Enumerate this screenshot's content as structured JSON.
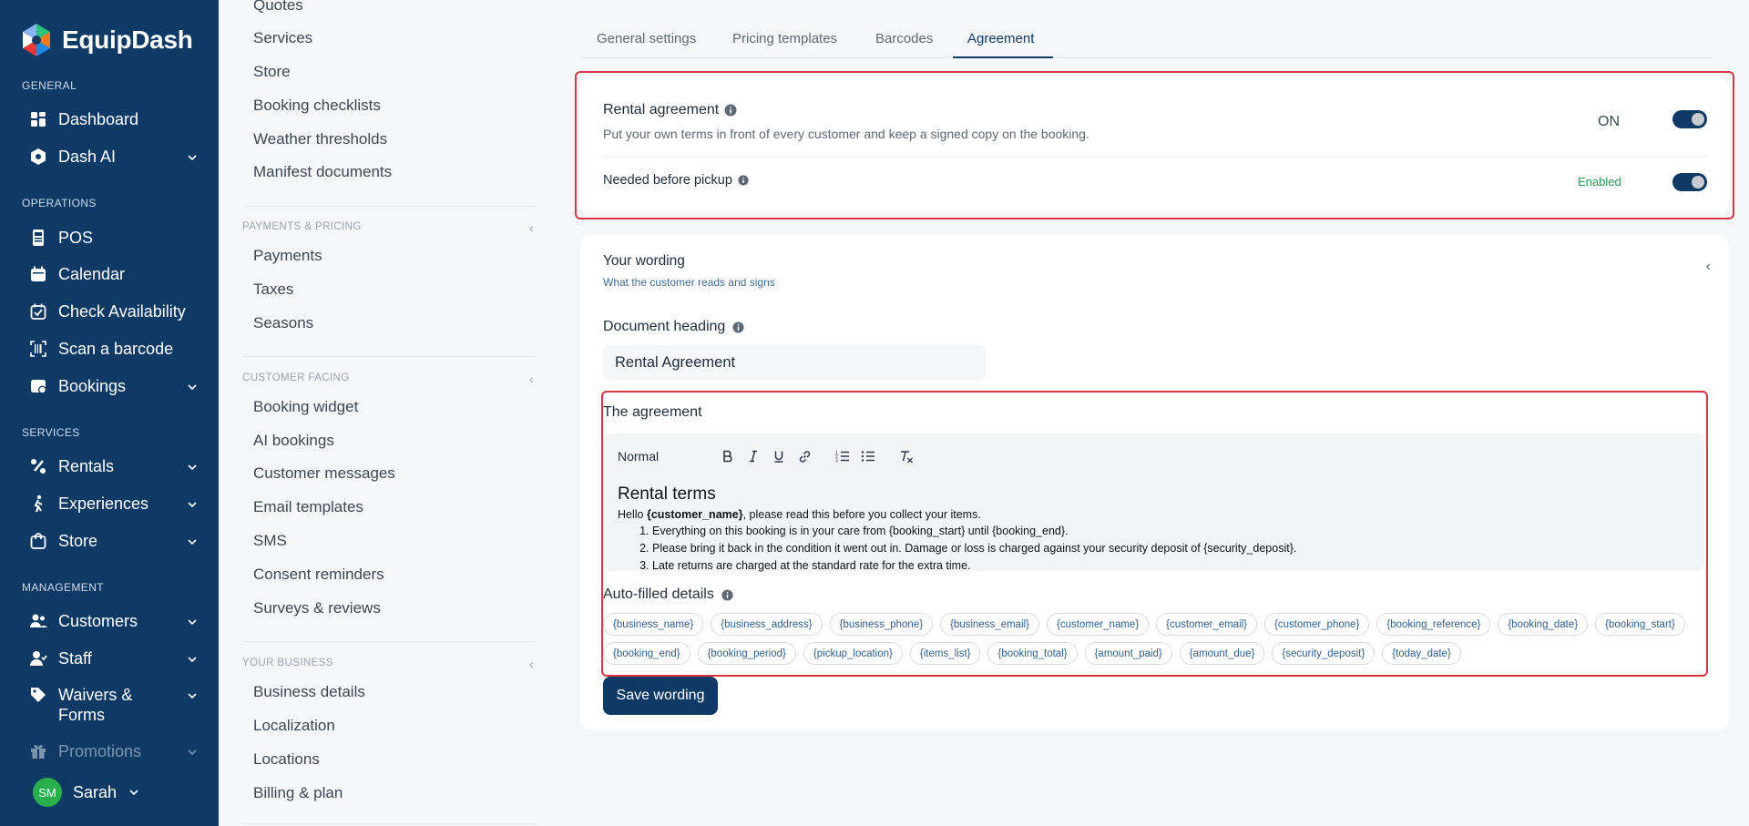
{
  "brand": {
    "name": "EquipDash"
  },
  "nav": {
    "sections": {
      "general": "GENERAL",
      "operations": "OPERATIONS",
      "services": "SERVICES",
      "management": "MANAGEMENT"
    },
    "items": [
      {
        "label": "Dashboard",
        "icon": "dashboard-icon"
      },
      {
        "label": "Dash AI",
        "icon": "ai-icon"
      },
      {
        "label": "POS",
        "icon": "pos-icon"
      },
      {
        "label": "Calendar",
        "icon": "calendar-icon"
      },
      {
        "label": "Check Availability",
        "icon": "calendar-check-icon"
      },
      {
        "label": "Scan a barcode",
        "icon": "barcode-scan-icon"
      },
      {
        "label": "Bookings",
        "icon": "bookings-icon"
      },
      {
        "label": "Rentals",
        "icon": "rentals-icon"
      },
      {
        "label": "Experiences",
        "icon": "experiences-icon"
      },
      {
        "label": "Store",
        "icon": "store-icon"
      },
      {
        "label": "Customers",
        "icon": "customers-icon"
      },
      {
        "label": "Staff",
        "icon": "staff-icon"
      },
      {
        "label": "Waivers & Forms",
        "icon": "tag-icon"
      },
      {
        "label": "Promotions",
        "icon": "gift-icon"
      }
    ],
    "user": {
      "initials": "SM",
      "name": "Sarah"
    }
  },
  "subnav": {
    "top_items": [
      "Quotes",
      "Services",
      "Store",
      "Booking checklists",
      "Weather thresholds",
      "Manifest documents"
    ],
    "payments_section": "PAYMENTS & PRICING",
    "payments_items": [
      "Payments",
      "Taxes",
      "Seasons"
    ],
    "customer_section": "CUSTOMER FACING",
    "customer_items": [
      "Booking widget",
      "AI bookings",
      "Customer messages",
      "Email templates",
      "SMS",
      "Consent reminders",
      "Surveys & reviews"
    ],
    "business_section": "YOUR BUSINESS",
    "business_items": [
      "Business details",
      "Localization",
      "Locations",
      "Billing & plan"
    ]
  },
  "tabs": [
    "General settings",
    "Pricing templates",
    "Barcodes",
    "Agreement"
  ],
  "active_tab": "Agreement",
  "rental_agreement": {
    "title": "Rental agreement",
    "description": "Put your own terms in front of every customer and keep a signed copy on the booking.",
    "status": "ON",
    "enabled": true
  },
  "needed_before_pickup": {
    "title": "Needed before pickup",
    "status": "Enabled",
    "enabled": true
  },
  "wording": {
    "title": "Your wording",
    "subtitle": "What the customer reads and signs",
    "heading_label": "Document heading",
    "heading_value": "Rental Agreement",
    "agreement_label": "The agreement",
    "format_select": "Normal",
    "doc": {
      "heading": "Rental terms",
      "intro_prefix": "Hello ",
      "intro_bold": "{customer_name}",
      "intro_suffix": ", please read this before you collect your items.",
      "list": [
        "Everything on this booking is in your care from {booking_start} until {booking_end}.",
        "Please bring it back in the condition it went out in. Damage or loss is charged against your security deposit of {security_deposit}.",
        "Late returns are charged at the standard rate for the extra time."
      ]
    },
    "auto_label": "Auto-filled details",
    "tokens": [
      "{business_name}",
      "{business_address}",
      "{business_phone}",
      "{business_email}",
      "{customer_name}",
      "{customer_email}",
      "{customer_phone}",
      "{booking_reference}",
      "{booking_date}",
      "{booking_start}",
      "{booking_end}",
      "{booking_period}",
      "{pickup_location}",
      "{items_list}",
      "{booking_total}",
      "{amount_paid}",
      "{amount_due}",
      "{security_deposit}",
      "{today_date}"
    ],
    "save_label": "Save wording"
  },
  "colors": {
    "nav_bg": "#0f3a66",
    "primary": "#0f3a66",
    "highlight": "#d93545",
    "enabled_green": "#23994a",
    "avatar_green": "#27b04b"
  }
}
